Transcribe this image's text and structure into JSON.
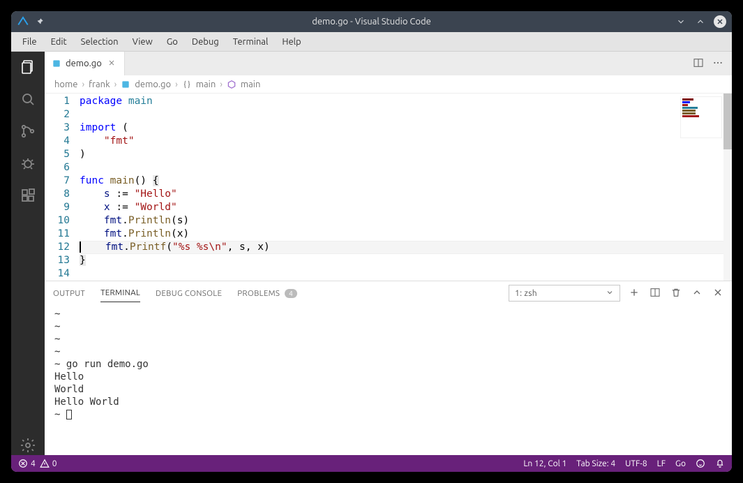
{
  "window": {
    "title": "demo.go - Visual Studio Code"
  },
  "menu": [
    "File",
    "Edit",
    "Selection",
    "View",
    "Go",
    "Debug",
    "Terminal",
    "Help"
  ],
  "tab": {
    "filename": "demo.go"
  },
  "breadcrumb": [
    "home",
    "frank",
    "demo.go",
    "main",
    "main"
  ],
  "code": {
    "line_count": 14,
    "current_line": 12
  },
  "panel": {
    "tabs": {
      "output": "OUTPUT",
      "terminal": "TERMINAL",
      "debug": "DEBUG CONSOLE",
      "problems": "PROBLEMS",
      "problems_badge": "4"
    },
    "terminal_selector": "1: zsh"
  },
  "terminal": {
    "lines": [
      "~",
      "~",
      "~",
      "~",
      "~ go run demo.go",
      "Hello",
      "World",
      "Hello World",
      "~ "
    ]
  },
  "status": {
    "errors": "4",
    "warnings": "0",
    "cursor": "Ln 12, Col 1",
    "tabsize": "Tab Size: 4",
    "encoding": "UTF-8",
    "eol": "LF",
    "lang": "Go"
  },
  "source": {
    "l1_package": "package ",
    "l1_main": "main",
    "l3_import": "import ",
    "l3_paren": "(",
    "l4_fmt": "\"fmt\"",
    "l5_paren": ")",
    "l7_func": "func ",
    "l7_main": "main",
    "l7_rest": "() ",
    "l7_brace": "{",
    "l8_s": "s",
    "l8_assign": " := ",
    "l8_hello": "\"Hello\"",
    "l9_x": "x",
    "l9_assign": " := ",
    "l9_world": "\"World\"",
    "l10_fmt": "fmt",
    "l10_dot": ".",
    "l10_println": "Println",
    "l10_args": "(s)",
    "l11_fmt": "fmt",
    "l11_dot": ".",
    "l11_println": "Println",
    "l11_args": "(x)",
    "l12_fmt": "fmt",
    "l12_dot": ".",
    "l12_printf": "Printf",
    "l12_open": "(",
    "l12_fmtstr": "\"%s %s\\n\"",
    "l12_rest": ", s, x)",
    "l13_brace": "}"
  }
}
